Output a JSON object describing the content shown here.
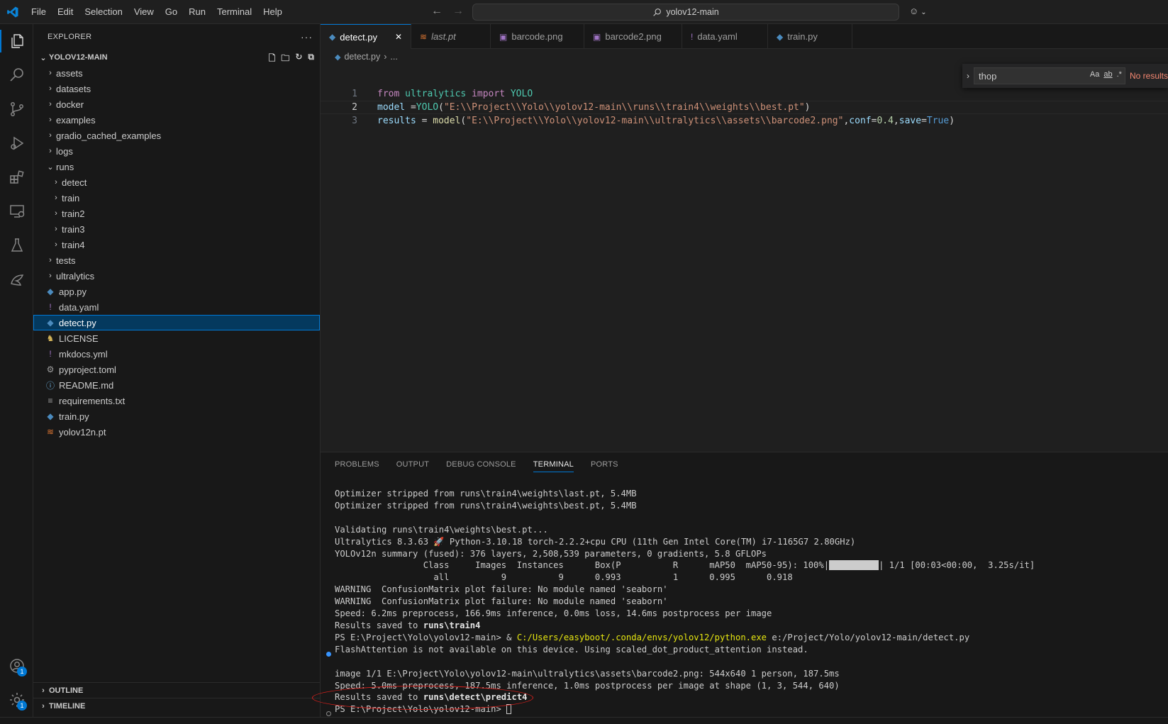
{
  "menu": [
    "File",
    "Edit",
    "Selection",
    "View",
    "Go",
    "Run",
    "Terminal",
    "Help"
  ],
  "search": {
    "text": "yolov12-main"
  },
  "explorer": {
    "title": "EXPLORER",
    "folder": "YOLOV12-MAIN",
    "items": [
      {
        "label": "assets",
        "kind": "folder",
        "depth": 0,
        "expanded": false
      },
      {
        "label": "datasets",
        "kind": "folder",
        "depth": 0,
        "expanded": false
      },
      {
        "label": "docker",
        "kind": "folder",
        "depth": 0,
        "expanded": false
      },
      {
        "label": "examples",
        "kind": "folder",
        "depth": 0,
        "expanded": false
      },
      {
        "label": "gradio_cached_examples",
        "kind": "folder",
        "depth": 0,
        "expanded": false
      },
      {
        "label": "logs",
        "kind": "folder",
        "depth": 0,
        "expanded": false
      },
      {
        "label": "runs",
        "kind": "folder",
        "depth": 0,
        "expanded": true
      },
      {
        "label": "detect",
        "kind": "folder",
        "depth": 1,
        "expanded": false
      },
      {
        "label": "train",
        "kind": "folder",
        "depth": 1,
        "expanded": false
      },
      {
        "label": "train2",
        "kind": "folder",
        "depth": 1,
        "expanded": false
      },
      {
        "label": "train3",
        "kind": "folder",
        "depth": 1,
        "expanded": false
      },
      {
        "label": "train4",
        "kind": "folder",
        "depth": 1,
        "expanded": false
      },
      {
        "label": "tests",
        "kind": "folder",
        "depth": 0,
        "expanded": false
      },
      {
        "label": "ultralytics",
        "kind": "folder",
        "depth": 0,
        "expanded": false
      },
      {
        "label": "app.py",
        "kind": "python",
        "depth": 0
      },
      {
        "label": "data.yaml",
        "kind": "yaml",
        "depth": 0
      },
      {
        "label": "detect.py",
        "kind": "python",
        "depth": 0,
        "selected": true
      },
      {
        "label": "LICENSE",
        "kind": "license",
        "depth": 0
      },
      {
        "label": "mkdocs.yml",
        "kind": "yaml",
        "depth": 0
      },
      {
        "label": "pyproject.toml",
        "kind": "toml",
        "depth": 0
      },
      {
        "label": "README.md",
        "kind": "info",
        "depth": 0
      },
      {
        "label": "requirements.txt",
        "kind": "text",
        "depth": 0
      },
      {
        "label": "train.py",
        "kind": "python",
        "depth": 0
      },
      {
        "label": "yolov12n.pt",
        "kind": "rss",
        "depth": 0
      }
    ],
    "outline": "OUTLINE",
    "timeline": "TIMELINE"
  },
  "tabs": [
    {
      "label": "detect.py",
      "kind": "python",
      "active": true,
      "italic": false,
      "width": 128
    },
    {
      "label": "last.pt",
      "kind": "rss",
      "active": false,
      "italic": true,
      "width": 112
    },
    {
      "label": "barcode.png",
      "kind": "image",
      "active": false,
      "italic": false,
      "width": 132
    },
    {
      "label": "barcode2.png",
      "kind": "image",
      "active": false,
      "italic": false,
      "width": 138
    },
    {
      "label": "data.yaml",
      "kind": "yaml",
      "active": false,
      "italic": false,
      "width": 121
    },
    {
      "label": "train.py",
      "kind": "python",
      "active": false,
      "italic": false,
      "width": 119
    }
  ],
  "breadcrumb": {
    "file": "detect.py",
    "rest": "..."
  },
  "find": {
    "value": "thop",
    "result": "No results",
    "opt_case": "Aa",
    "opt_word": "ab",
    "opt_regex": ".*"
  },
  "code": {
    "line_numbers": [
      "1",
      "2",
      "3"
    ],
    "line1": {
      "kw1": "from",
      "mod": "ultralytics",
      "kw2": "import",
      "cls": "YOLO"
    },
    "line2": {
      "var": "model",
      "op": " =",
      "fn": "YOLO",
      "p1": "(",
      "str": "\"E:\\\\Project\\\\Yolo\\\\yolov12-main\\\\runs\\\\train4\\\\weights\\\\best.pt\"",
      "p2": ")"
    },
    "line3": {
      "var": "results",
      "op": " = ",
      "fn": "model",
      "p1": "(",
      "str": "\"E:\\\\Project\\\\Yolo\\\\yolov12-main\\\\ultralytics\\\\assets\\\\barcode2.png\"",
      "c1": ",",
      "k1": "conf",
      "eq1": "=",
      "n1": "0.4",
      "c2": ",",
      "k2": "save",
      "eq2": "=",
      "b1": "True",
      "p2": ")"
    }
  },
  "panel": {
    "tabs": [
      "PROBLEMS",
      "OUTPUT",
      "DEBUG CONSOLE",
      "TERMINAL",
      "PORTS"
    ],
    "active_tab": "TERMINAL"
  },
  "terminal": {
    "l1": "Optimizer stripped from runs\\train4\\weights\\last.pt, 5.4MB",
    "l2": "Optimizer stripped from runs\\train4\\weights\\best.pt, 5.4MB",
    "l3": "",
    "l4": "Validating runs\\train4\\weights\\best.pt...",
    "l5": "Ultralytics 8.3.63 🚀 Python-3.10.18 torch-2.2.2+cpu CPU (11th Gen Intel Core(TM) i7-1165G7 2.80GHz)",
    "l6": "YOLOv12n summary (fused): 376 layers, 2,508,539 parameters, 0 gradients, 5.8 GFLOPs",
    "l7a": "                 Class     Images  Instances      Box(P          R      mAP50  mAP50-95): 100%|",
    "l7b": "| 1/1 [00:03<00:00,  3.25s/it]",
    "l8": "                   all          9          9      0.993          1      0.995      0.918",
    "l9": "WARNING  ConfusionMatrix plot failure: No module named 'seaborn'",
    "l10": "WARNING  ConfusionMatrix plot failure: No module named 'seaborn'",
    "l11": "Speed: 6.2ms preprocess, 166.9ms inference, 0.0ms loss, 14.6ms postprocess per image",
    "l12a": "Results saved to ",
    "l12b": "runs\\train4",
    "l13a": "PS E:\\Project\\Yolo\\yolov12-main> & ",
    "l13b": "C:/Users/easyboot/.conda/envs/yolov12/python.exe",
    "l13c": " e:/Project/Yolo/yolov12-main/detect.py",
    "l14": "FlashAttention is not available on this device. Using scaled_dot_product_attention instead.",
    "l15": "",
    "l16": "image 1/1 E:\\Project\\Yolo\\yolov12-main\\ultralytics\\assets\\barcode2.png: 544x640 1 person, 187.5ms",
    "l17": "Speed: 5.0ms preprocess, 187.5ms inference, 1.0ms postprocess per image at shape (1, 3, 544, 640)",
    "l18a": "Results saved to ",
    "l18b": "runs\\detect\\predict4",
    "l19": "PS E:\\Project\\Yolo\\yolov12-main> "
  },
  "activity_badges": {
    "accounts": "1",
    "manage": "1"
  },
  "colors": {
    "accent": "#0078d4",
    "selection": "#04395e",
    "annotation": "#d9201c"
  }
}
